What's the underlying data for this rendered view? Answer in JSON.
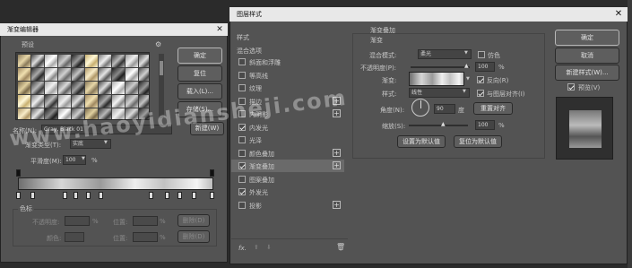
{
  "left_dialog": {
    "title": "渐变编辑器",
    "presets_label": "预设",
    "buttons": {
      "ok": "确定",
      "reset": "复位",
      "load": "载入(L)...",
      "save": "存储(S)...",
      "new": "新建(W)"
    },
    "name_label": "名称(N):",
    "name_value": "Gray, Black 01",
    "gradient_type_label": "渐变类型(T):",
    "gradient_type_value": "实底",
    "smoothness_label": "平滑度(M):",
    "smoothness_value": "100",
    "smoothness_unit": "%",
    "stops_label": "色标",
    "opacity_label": "不透明度:",
    "position_label": "位置:",
    "delete_label": "删除(D)",
    "color_label": "颜色:",
    "percent": "%"
  },
  "right_dialog": {
    "title": "图层样式",
    "close_icon": "x-close-icon",
    "styles_header": "样式",
    "blend_options": "混合选项",
    "style_items": [
      {
        "label": "斜面和浮雕",
        "checked": false,
        "plus": false
      },
      {
        "label": "等高线",
        "checked": false,
        "plus": false
      },
      {
        "label": "纹理",
        "checked": false,
        "plus": false
      },
      {
        "label": "描边",
        "checked": false,
        "plus": true
      },
      {
        "label": "内阴影",
        "checked": false,
        "plus": true
      },
      {
        "label": "内发光",
        "checked": true,
        "plus": false
      },
      {
        "label": "光泽",
        "checked": false,
        "plus": false
      },
      {
        "label": "颜色叠加",
        "checked": false,
        "plus": true
      },
      {
        "label": "渐变叠加",
        "checked": true,
        "plus": true
      },
      {
        "label": "图案叠加",
        "checked": false,
        "plus": false
      },
      {
        "label": "外发光",
        "checked": true,
        "plus": false
      },
      {
        "label": "投影",
        "checked": false,
        "plus": true
      }
    ],
    "fx_label": "fx.",
    "section_title": "渐变叠加",
    "sub_title": "渐变",
    "blend_mode_label": "混合模式:",
    "blend_mode_value": "柔光",
    "dither_label": "仿色",
    "opacity_label": "不透明度(P):",
    "opacity_value": "100",
    "gradient_label": "渐变:",
    "reverse_label": "反向(R)",
    "style_label": "样式:",
    "style_value": "线性",
    "align_label": "与图层对齐(I)",
    "angle_label": "角度(N):",
    "angle_value": "90",
    "angle_unit": "度",
    "reset_align": "重置对齐",
    "scale_label": "缩放(S):",
    "scale_value": "100",
    "percent": "%",
    "set_default": "设置为默认值",
    "reset_default": "复位为默认值",
    "buttons": {
      "ok": "确定",
      "cancel": "取消",
      "new_style": "新建样式(W)...",
      "preview": "预览(V)"
    }
  },
  "watermark": "www.haoyidiansheji.com"
}
